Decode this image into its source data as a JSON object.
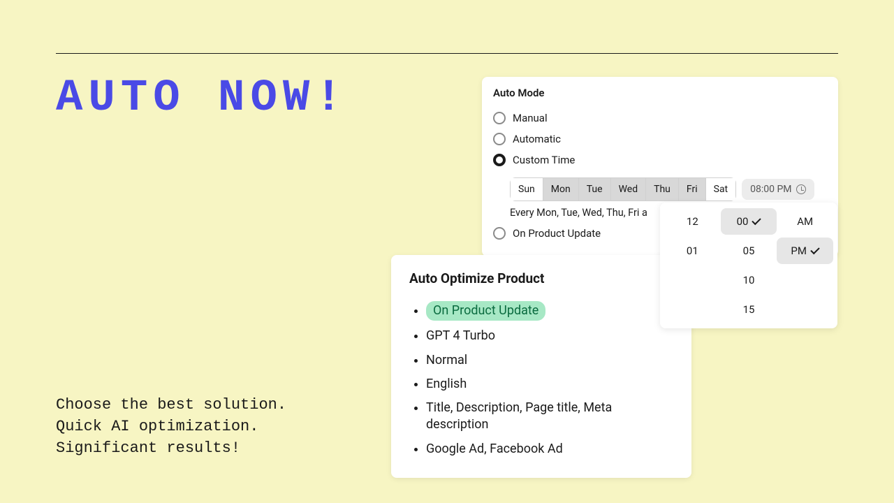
{
  "hero": {
    "title": "AUTO NOW!",
    "tagline_line1": "Choose the best solution.",
    "tagline_line2": "Quick AI optimization.",
    "tagline_line3": "Significant results!"
  },
  "auto_mode": {
    "title": "Auto Mode",
    "options": {
      "manual": "Manual",
      "automatic": "Automatic",
      "custom_time": "Custom Time",
      "on_product_update": "On Product Update"
    },
    "days": {
      "sun": "Sun",
      "mon": "Mon",
      "tue": "Tue",
      "wed": "Wed",
      "thu": "Thu",
      "fri": "Fri",
      "sat": "Sat"
    },
    "time_value": "08:00 PM",
    "schedule_text": "Every Mon, Tue, Wed, Thu, Fri a"
  },
  "time_picker": {
    "hours": [
      "12",
      "01"
    ],
    "minutes": [
      "00",
      "05",
      "10",
      "15"
    ],
    "ampm": [
      "AM",
      "PM"
    ],
    "selected_minute": "00",
    "selected_ampm": "PM"
  },
  "optimize_card": {
    "title": "Auto Optimize Product",
    "items": [
      "On Product Update",
      "GPT 4 Turbo",
      "Normal",
      "English",
      "Title, Description, Page title, Meta description",
      "Google Ad, Facebook Ad"
    ]
  }
}
